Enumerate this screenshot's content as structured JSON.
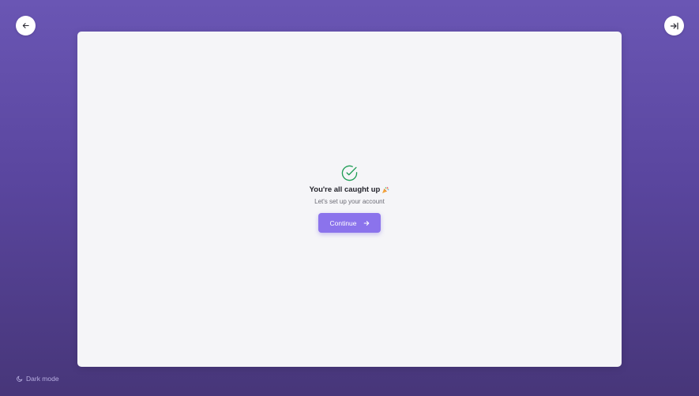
{
  "nav": {
    "back_icon": "arrow-left-icon",
    "skip_icon": "arrow-right-to-line-icon"
  },
  "card": {
    "status_icon": "check-circle-icon",
    "heading": "You're all caught up",
    "heading_emoji": "party-popper-icon",
    "subtext": "Let's set up your account",
    "continue_label": "Continue",
    "continue_icon": "arrow-right-icon"
  },
  "footer": {
    "dark_mode_label": "Dark mode",
    "dark_mode_icon": "moon-icon"
  },
  "colors": {
    "background_top": "#6a56b4",
    "background_bottom": "#473679",
    "card": "#f5f5f8",
    "accent": "#8b73ec",
    "success": "#1f9d55"
  }
}
